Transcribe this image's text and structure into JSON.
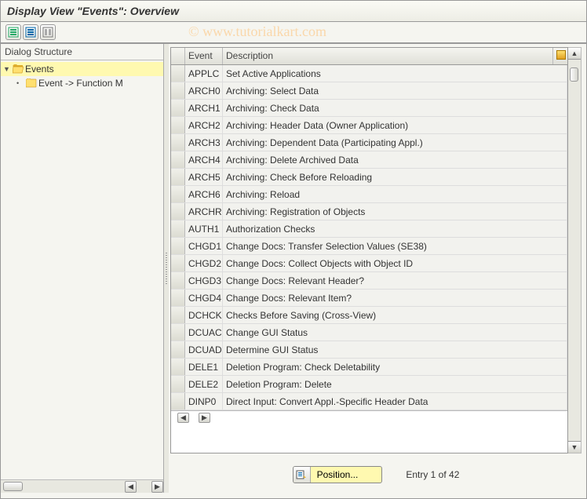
{
  "title": "Display View \"Events\": Overview",
  "watermark": "© www.tutorialkart.com",
  "sidebar": {
    "header": "Dialog Structure",
    "items": [
      {
        "label": "Events",
        "selected": true
      },
      {
        "label": "Event -> Function M",
        "selected": false
      }
    ]
  },
  "grid": {
    "columns": {
      "event": "Event",
      "description": "Description"
    },
    "rows": [
      {
        "event": "APPLC",
        "desc": "Set Active Applications"
      },
      {
        "event": "ARCH0",
        "desc": "Archiving: Select Data"
      },
      {
        "event": "ARCH1",
        "desc": "Archiving: Check Data"
      },
      {
        "event": "ARCH2",
        "desc": "Archiving: Header Data (Owner Application)"
      },
      {
        "event": "ARCH3",
        "desc": "Archiving: Dependent Data (Participating Appl.)"
      },
      {
        "event": "ARCH4",
        "desc": "Archiving: Delete Archived Data"
      },
      {
        "event": "ARCH5",
        "desc": "Archiving: Check Before Reloading"
      },
      {
        "event": "ARCH6",
        "desc": "Archiving: Reload"
      },
      {
        "event": "ARCHR",
        "desc": "Archiving: Registration of Objects"
      },
      {
        "event": "AUTH1",
        "desc": "Authorization Checks"
      },
      {
        "event": "CHGD1",
        "desc": "Change Docs: Transfer Selection Values (SE38)"
      },
      {
        "event": "CHGD2",
        "desc": "Change Docs: Collect Objects with Object ID"
      },
      {
        "event": "CHGD3",
        "desc": "Change Docs: Relevant Header?"
      },
      {
        "event": "CHGD4",
        "desc": "Change Docs: Relevant Item?"
      },
      {
        "event": "DCHCK",
        "desc": "Checks Before Saving (Cross-View)"
      },
      {
        "event": "DCUAC",
        "desc": "Change GUI Status"
      },
      {
        "event": "DCUAD",
        "desc": "Determine GUI Status"
      },
      {
        "event": "DELE1",
        "desc": "Deletion Program: Check Deletability"
      },
      {
        "event": "DELE2",
        "desc": "Deletion Program: Delete"
      },
      {
        "event": "DINP0",
        "desc": "Direct Input: Convert Appl.-Specific Header Data"
      }
    ]
  },
  "footer": {
    "position_label": "Position...",
    "entry_status": "Entry 1 of 42"
  }
}
